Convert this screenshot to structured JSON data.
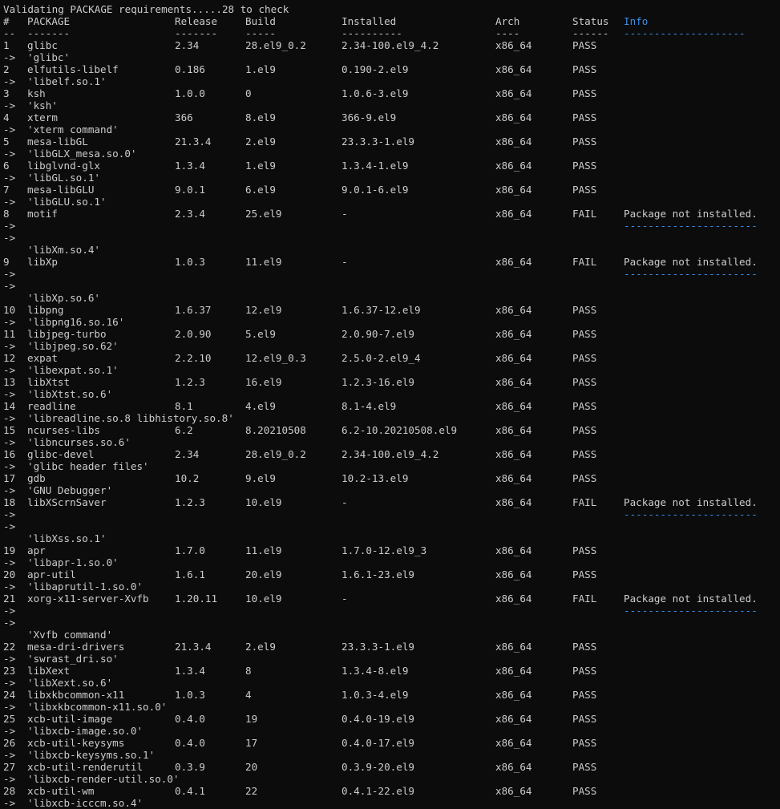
{
  "header": {
    "title_line": "Validating PACKAGE requirements.....28 to check",
    "columns": [
      "#",
      "PACKAGE",
      "Release",
      "Build",
      "Installed",
      "Arch",
      "Status",
      "Info"
    ],
    "separators": [
      "--",
      "-------",
      "-------",
      "-----",
      "----------",
      "----",
      "------",
      "--------------------"
    ]
  },
  "colors": {
    "background": "#0c0c0c",
    "text": "#cccccc",
    "info_accent": "#3b8eea"
  },
  "arrow": "->",
  "rows": [
    {
      "num": "1",
      "pkg": "glibc",
      "release": "2.34",
      "build": "28.el9_0.2",
      "installed": "2.34-100.el9_4.2",
      "arch": "x86_64",
      "status": "PASS",
      "info": "",
      "desc": "'glibc'"
    },
    {
      "num": "2",
      "pkg": "elfutils-libelf",
      "release": "0.186",
      "build": "1.el9",
      "installed": "0.190-2.el9",
      "arch": "x86_64",
      "status": "PASS",
      "info": "",
      "desc": "'libelf.so.1'"
    },
    {
      "num": "3",
      "pkg": "ksh",
      "release": "1.0.0",
      "build": "0",
      "installed": "1.0.6-3.el9",
      "arch": "x86_64",
      "status": "PASS",
      "info": "",
      "desc": "'ksh'"
    },
    {
      "num": "4",
      "pkg": "xterm",
      "release": "366",
      "build": "8.el9",
      "installed": "366-9.el9",
      "arch": "x86_64",
      "status": "PASS",
      "info": "",
      "desc": "'xterm command'"
    },
    {
      "num": "5",
      "pkg": "mesa-libGL",
      "release": "21.3.4",
      "build": "2.el9",
      "installed": "23.3.3-1.el9",
      "arch": "x86_64",
      "status": "PASS",
      "info": "",
      "desc": "'libGLX_mesa.so.0'"
    },
    {
      "num": "6",
      "pkg": "libglvnd-glx",
      "release": "1.3.4",
      "build": "1.el9",
      "installed": "1.3.4-1.el9",
      "arch": "x86_64",
      "status": "PASS",
      "info": "",
      "desc": "'libGL.so.1'"
    },
    {
      "num": "7",
      "pkg": "mesa-libGLU",
      "release": "9.0.1",
      "build": "6.el9",
      "installed": "9.0.1-6.el9",
      "arch": "x86_64",
      "status": "PASS",
      "info": "",
      "desc": "'libGLU.so.1'"
    },
    {
      "num": "8",
      "pkg": "motif",
      "release": "2.3.4",
      "build": "25.el9",
      "installed": "-",
      "arch": "x86_64",
      "status": "FAIL",
      "info": "Package not installed.",
      "info_dashes": "----------------------",
      "desc": "'libXm.so.4'"
    },
    {
      "num": "9",
      "pkg": "libXp",
      "release": "1.0.3",
      "build": "11.el9",
      "installed": "-",
      "arch": "x86_64",
      "status": "FAIL",
      "info": "Package not installed.",
      "info_dashes": "----------------------",
      "desc": "'libXp.so.6'"
    },
    {
      "num": "10",
      "pkg": "libpng",
      "release": "1.6.37",
      "build": "12.el9",
      "installed": "1.6.37-12.el9",
      "arch": "x86_64",
      "status": "PASS",
      "info": "",
      "desc": "'libpng16.so.16'"
    },
    {
      "num": "11",
      "pkg": "libjpeg-turbo",
      "release": "2.0.90",
      "build": "5.el9",
      "installed": "2.0.90-7.el9",
      "arch": "x86_64",
      "status": "PASS",
      "info": "",
      "desc": "'libjpeg.so.62'"
    },
    {
      "num": "12",
      "pkg": "expat",
      "release": "2.2.10",
      "build": "12.el9_0.3",
      "installed": "2.5.0-2.el9_4",
      "arch": "x86_64",
      "status": "PASS",
      "info": "",
      "desc": "'libexpat.so.1'"
    },
    {
      "num": "13",
      "pkg": "libXtst",
      "release": "1.2.3",
      "build": "16.el9",
      "installed": "1.2.3-16.el9",
      "arch": "x86_64",
      "status": "PASS",
      "info": "",
      "desc": "'libXtst.so.6'"
    },
    {
      "num": "14",
      "pkg": "readline",
      "release": "8.1",
      "build": "4.el9",
      "installed": "8.1-4.el9",
      "arch": "x86_64",
      "status": "PASS",
      "info": "",
      "desc": "'libreadline.so.8 libhistory.so.8'"
    },
    {
      "num": "15",
      "pkg": "ncurses-libs",
      "release": "6.2",
      "build": "8.20210508",
      "installed": "6.2-10.20210508.el9",
      "arch": "x86_64",
      "status": "PASS",
      "info": "",
      "desc": "'libncurses.so.6'"
    },
    {
      "num": "16",
      "pkg": "glibc-devel",
      "release": "2.34",
      "build": "28.el9_0.2",
      "installed": "2.34-100.el9_4.2",
      "arch": "x86_64",
      "status": "PASS",
      "info": "",
      "desc": "'glibc header files'"
    },
    {
      "num": "17",
      "pkg": "gdb",
      "release": "10.2",
      "build": "9.el9",
      "installed": "10.2-13.el9",
      "arch": "x86_64",
      "status": "PASS",
      "info": "",
      "desc": "'GNU Debugger'"
    },
    {
      "num": "18",
      "pkg": "libXScrnSaver",
      "release": "1.2.3",
      "build": "10.el9",
      "installed": "-",
      "arch": "x86_64",
      "status": "FAIL",
      "info": "Package not installed.",
      "info_dashes": "----------------------",
      "desc": "'libXss.so.1'"
    },
    {
      "num": "19",
      "pkg": "apr",
      "release": "1.7.0",
      "build": "11.el9",
      "installed": "1.7.0-12.el9_3",
      "arch": "x86_64",
      "status": "PASS",
      "info": "",
      "desc": "'libapr-1.so.0'"
    },
    {
      "num": "20",
      "pkg": "apr-util",
      "release": "1.6.1",
      "build": "20.el9",
      "installed": "1.6.1-23.el9",
      "arch": "x86_64",
      "status": "PASS",
      "info": "",
      "desc": "'libaprutil-1.so.0'"
    },
    {
      "num": "21",
      "pkg": "xorg-x11-server-Xvfb",
      "release": "1.20.11",
      "build": "10.el9",
      "installed": "-",
      "arch": "x86_64",
      "status": "FAIL",
      "info": "Package not installed.",
      "info_dashes": "----------------------",
      "desc": "'Xvfb command'"
    },
    {
      "num": "22",
      "pkg": "mesa-dri-drivers",
      "release": "21.3.4",
      "build": "2.el9",
      "installed": "23.3.3-1.el9",
      "arch": "x86_64",
      "status": "PASS",
      "info": "",
      "desc": "'swrast_dri.so'"
    },
    {
      "num": "23",
      "pkg": "libXext",
      "release": "1.3.4",
      "build": "8",
      "installed": "1.3.4-8.el9",
      "arch": "x86_64",
      "status": "PASS",
      "info": "",
      "desc": "'libXext.so.6'"
    },
    {
      "num": "24",
      "pkg": "libxkbcommon-x11",
      "release": "1.0.3",
      "build": "4",
      "installed": "1.0.3-4.el9",
      "arch": "x86_64",
      "status": "PASS",
      "info": "",
      "desc": "'libxkbcommon-x11.so.0'"
    },
    {
      "num": "25",
      "pkg": "xcb-util-image",
      "release": "0.4.0",
      "build": "19",
      "installed": "0.4.0-19.el9",
      "arch": "x86_64",
      "status": "PASS",
      "info": "",
      "desc": "'libxcb-image.so.0'"
    },
    {
      "num": "26",
      "pkg": "xcb-util-keysyms",
      "release": "0.4.0",
      "build": "17",
      "installed": "0.4.0-17.el9",
      "arch": "x86_64",
      "status": "PASS",
      "info": "",
      "desc": "'libxcb-keysyms.so.1'"
    },
    {
      "num": "27",
      "pkg": "xcb-util-renderutil",
      "release": "0.3.9",
      "build": "20",
      "installed": "0.3.9-20.el9",
      "arch": "x86_64",
      "status": "PASS",
      "info": "",
      "desc": "'libxcb-render-util.so.0'"
    },
    {
      "num": "28",
      "pkg": "xcb-util-wm",
      "release": "0.4.1",
      "build": "22",
      "installed": "0.4.1-22.el9",
      "arch": "x86_64",
      "status": "PASS",
      "info": "",
      "desc": "'libxcb-icccm.so.4'"
    }
  ]
}
